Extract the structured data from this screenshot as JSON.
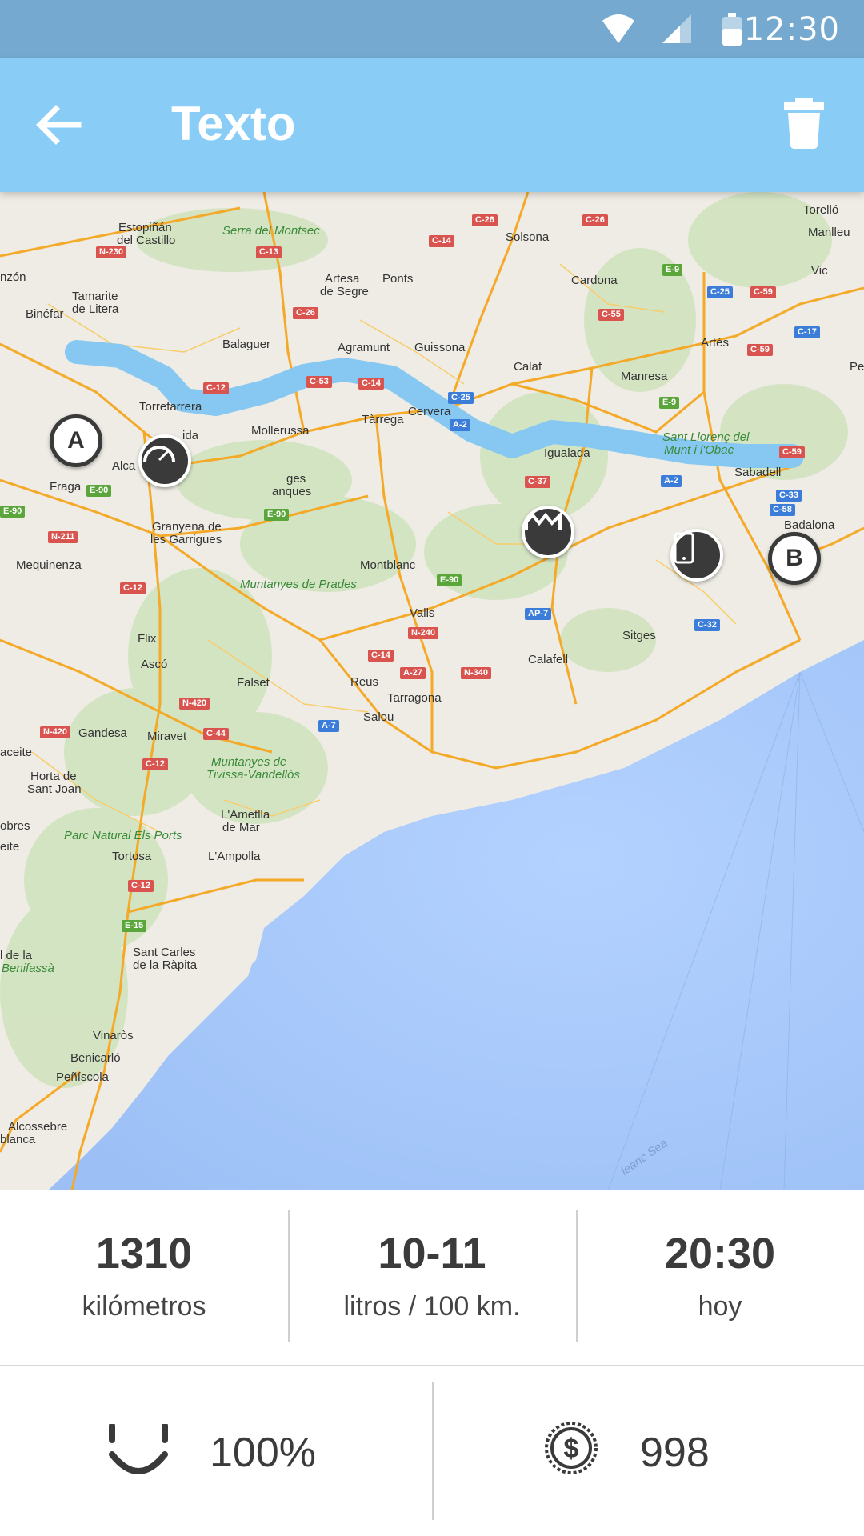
{
  "status_bar": {
    "time": "12:30"
  },
  "app_bar": {
    "title": "Texto"
  },
  "map": {
    "markers": {
      "start": "A",
      "end": "B"
    },
    "place_labels": [
      {
        "text": "Estopiñán",
        "t": "town"
      },
      {
        "text": "del Castillo",
        "t": "town"
      },
      {
        "text": "Serra del Montsec",
        "t": "park"
      },
      {
        "text": "Solsona",
        "t": "town"
      },
      {
        "text": "Torelló",
        "t": "town"
      },
      {
        "text": "Manlleu",
        "t": "town"
      },
      {
        "text": "nzón",
        "t": "town"
      },
      {
        "text": "Tamarite",
        "t": "town"
      },
      {
        "text": "de Litera",
        "t": "town"
      },
      {
        "text": "Binéfar",
        "t": "town"
      },
      {
        "text": "Artesa",
        "t": "town"
      },
      {
        "text": "de Segre",
        "t": "town"
      },
      {
        "text": "Ponts",
        "t": "town"
      },
      {
        "text": "Cardona",
        "t": "town"
      },
      {
        "text": "Vic",
        "t": "town"
      },
      {
        "text": "Balaguer",
        "t": "town"
      },
      {
        "text": "Agramunt",
        "t": "town"
      },
      {
        "text": "Guissona",
        "t": "town"
      },
      {
        "text": "Artés",
        "t": "town"
      },
      {
        "text": "Calaf",
        "t": "town"
      },
      {
        "text": "Manresa",
        "t": "town"
      },
      {
        "text": "Torrefarrera",
        "t": "town"
      },
      {
        "text": "Mollerussa",
        "t": "town"
      },
      {
        "text": "Tàrrega",
        "t": "town"
      },
      {
        "text": "Cervera",
        "t": "town"
      },
      {
        "text": "Sant Llorenç del",
        "t": "park"
      },
      {
        "text": "Munt i l'Obac",
        "t": "park"
      },
      {
        "text": "Igualada",
        "t": "town"
      },
      {
        "text": "Sabadell",
        "t": "town"
      },
      {
        "text": "Fraga",
        "t": "town"
      },
      {
        "text": "Alca",
        "t": "town"
      },
      {
        "text": "ida",
        "t": "town"
      },
      {
        "text": "ges",
        "t": "town"
      },
      {
        "text": "anques",
        "t": "town"
      },
      {
        "text": "Badalona",
        "t": "town"
      },
      {
        "text": "Granyena de",
        "t": "town"
      },
      {
        "text": "les Garrigues",
        "t": "town"
      },
      {
        "text": "Mequinenza",
        "t": "town"
      },
      {
        "text": "Montblanc",
        "t": "town"
      },
      {
        "text": "Muntanyes de Prades",
        "t": "park"
      },
      {
        "text": "Valls",
        "t": "town"
      },
      {
        "text": "Flix",
        "t": "town"
      },
      {
        "text": "Sitges",
        "t": "town"
      },
      {
        "text": "Calafell",
        "t": "town"
      },
      {
        "text": "Ascó",
        "t": "town"
      },
      {
        "text": "Falset",
        "t": "town"
      },
      {
        "text": "Reus",
        "t": "town"
      },
      {
        "text": "Tarragona",
        "t": "town"
      },
      {
        "text": "Salou",
        "t": "town"
      },
      {
        "text": "Gandesa",
        "t": "town"
      },
      {
        "text": "Miravet",
        "t": "town"
      },
      {
        "text": "aceite",
        "t": "town"
      },
      {
        "text": "Muntanyes de",
        "t": "park"
      },
      {
        "text": "Tivissa-Vandellòs",
        "t": "park"
      },
      {
        "text": "Horta de",
        "t": "town"
      },
      {
        "text": "Sant Joan",
        "t": "town"
      },
      {
        "text": "L'Ametlla",
        "t": "town"
      },
      {
        "text": "de Mar",
        "t": "town"
      },
      {
        "text": "obres",
        "t": "town"
      },
      {
        "text": "eite",
        "t": "town"
      },
      {
        "text": "Parc Natural Els Ports",
        "t": "park"
      },
      {
        "text": "Tortosa",
        "t": "town"
      },
      {
        "text": "L'Ampolla",
        "t": "town"
      },
      {
        "text": "l de la",
        "t": "town"
      },
      {
        "text": "Benifassà",
        "t": "park"
      },
      {
        "text": "Sant Carles",
        "t": "town"
      },
      {
        "text": "de la Ràpita",
        "t": "town"
      },
      {
        "text": "Vinaròs",
        "t": "town"
      },
      {
        "text": "Benicarló",
        "t": "town"
      },
      {
        "text": "Peñíscola",
        "t": "town"
      },
      {
        "text": "Alcossebre",
        "t": "town"
      },
      {
        "text": "blanca",
        "t": "town"
      },
      {
        "text": "learic Sea",
        "t": "sea"
      },
      {
        "text": "Pe",
        "t": "town"
      }
    ],
    "road_labels": [
      {
        "text": "C-26",
        "c": "red"
      },
      {
        "text": "C-26",
        "c": "red"
      },
      {
        "text": "C-14",
        "c": "red"
      },
      {
        "text": "N-230",
        "c": "red"
      },
      {
        "text": "C-13",
        "c": "red"
      },
      {
        "text": "E-9",
        "c": "green"
      },
      {
        "text": "C-25",
        "c": "blue"
      },
      {
        "text": "C-59",
        "c": "red"
      },
      {
        "text": "C-26",
        "c": "red"
      },
      {
        "text": "C-55",
        "c": "red"
      },
      {
        "text": "C-17",
        "c": "blue"
      },
      {
        "text": "C-59",
        "c": "red"
      },
      {
        "text": "C-53",
        "c": "red"
      },
      {
        "text": "C-14",
        "c": "red"
      },
      {
        "text": "C-12",
        "c": "red"
      },
      {
        "text": "C-25",
        "c": "blue"
      },
      {
        "text": "E-9",
        "c": "green"
      },
      {
        "text": "A-2",
        "c": "blue"
      },
      {
        "text": "C-59",
        "c": "red"
      },
      {
        "text": "A-2",
        "c": "blue"
      },
      {
        "text": "C-37",
        "c": "red"
      },
      {
        "text": "E-90",
        "c": "green"
      },
      {
        "text": "E-90",
        "c": "green"
      },
      {
        "text": "E-90",
        "c": "green"
      },
      {
        "text": "C-33",
        "c": "blue"
      },
      {
        "text": "C-58",
        "c": "blue"
      },
      {
        "text": "N-211",
        "c": "red"
      },
      {
        "text": "C-12",
        "c": "red"
      },
      {
        "text": "E-90",
        "c": "green"
      },
      {
        "text": "AP-7",
        "c": "blue"
      },
      {
        "text": "C-14",
        "c": "red"
      },
      {
        "text": "N-240",
        "c": "red"
      },
      {
        "text": "C-32",
        "c": "blue"
      },
      {
        "text": "A-27",
        "c": "red"
      },
      {
        "text": "N-340",
        "c": "red"
      },
      {
        "text": "N-420",
        "c": "red"
      },
      {
        "text": "A-7",
        "c": "blue"
      },
      {
        "text": "N-420",
        "c": "red"
      },
      {
        "text": "C-44",
        "c": "red"
      },
      {
        "text": "C-12",
        "c": "red"
      },
      {
        "text": "C-12",
        "c": "red"
      },
      {
        "text": "E-15",
        "c": "green"
      }
    ]
  },
  "stats": {
    "distance": {
      "value": "1310",
      "label": "kilómetros"
    },
    "consumption": {
      "value": "10-11",
      "label": "litros / 100 km."
    },
    "time": {
      "value": "20:30",
      "label": "hoy"
    },
    "happiness": {
      "value": "100%",
      "icon": "smile-icon"
    },
    "cost": {
      "value": "998",
      "icon": "dollar-coin-icon"
    }
  },
  "colors": {
    "status_bar": "#75a9cf",
    "app_bar": "#89cdf7",
    "route": "#86c8f2",
    "marker_dark": "#3a3a3a",
    "land": "#eeece4",
    "sea": "#a8c8fb"
  }
}
